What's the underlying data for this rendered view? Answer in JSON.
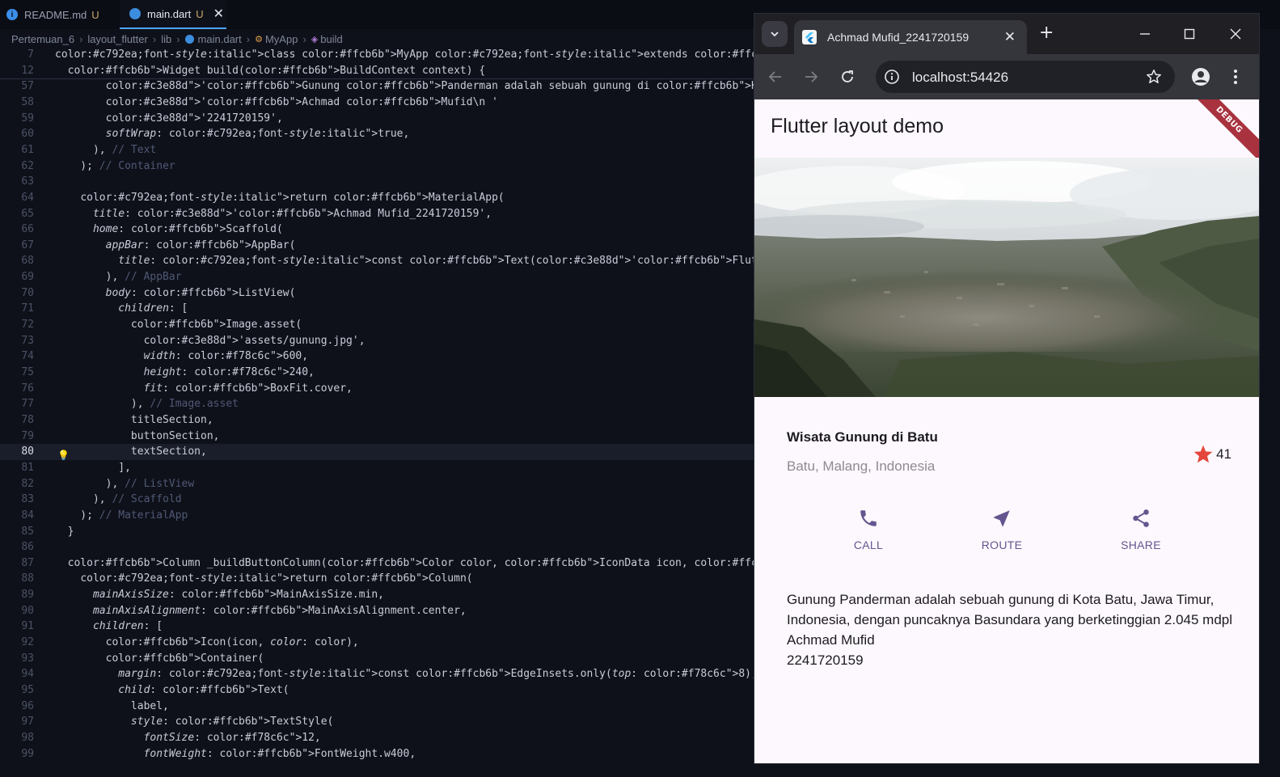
{
  "editor": {
    "tabs": [
      {
        "name": "README.md",
        "status": "U"
      },
      {
        "name": "main.dart",
        "status": "U",
        "close": "✕"
      }
    ],
    "breadcrumb": [
      "Pertemuan_6",
      "layout_flutter",
      "lib",
      "main.dart",
      "MyApp",
      "build"
    ],
    "lines": [
      {
        "n": "7",
        "t": "class MyApp extends StatelessWidget {"
      },
      {
        "n": "12",
        "t": "  Widget build(BuildContext context) {"
      },
      {
        "n": "57",
        "t": "        'Gunung Panderman adalah sebuah gunung di Kota Batu, Jawa Timur, Indonesia, dengan puncaknya Basundara"
      },
      {
        "n": "58",
        "t": "        'Achmad Mufid\\n '"
      },
      {
        "n": "59",
        "t": "        '2241720159',"
      },
      {
        "n": "60",
        "t": "        softWrap: true,"
      },
      {
        "n": "61",
        "t": "      ), // Text"
      },
      {
        "n": "62",
        "t": "    ); // Container"
      },
      {
        "n": "63",
        "t": ""
      },
      {
        "n": "64",
        "t": "    return MaterialApp("
      },
      {
        "n": "65",
        "t": "      title: 'Achmad Mufid_2241720159',"
      },
      {
        "n": "66",
        "t": "      home: Scaffold("
      },
      {
        "n": "67",
        "t": "        appBar: AppBar("
      },
      {
        "n": "68",
        "t": "          title: const Text('Flutter layout demo'),"
      },
      {
        "n": "69",
        "t": "        ), // AppBar"
      },
      {
        "n": "70",
        "t": "        body: ListView("
      },
      {
        "n": "71",
        "t": "          children: ["
      },
      {
        "n": "72",
        "t": "            Image.asset("
      },
      {
        "n": "73",
        "t": "              'assets/gunung.jpg',"
      },
      {
        "n": "74",
        "t": "              width: 600,"
      },
      {
        "n": "75",
        "t": "              height: 240,"
      },
      {
        "n": "76",
        "t": "              fit: BoxFit.cover,"
      },
      {
        "n": "77",
        "t": "            ), // Image.asset"
      },
      {
        "n": "78",
        "t": "            titleSection,"
      },
      {
        "n": "79",
        "t": "            buttonSection,"
      },
      {
        "n": "80",
        "t": "            textSection,"
      },
      {
        "n": "81",
        "t": "          ],"
      },
      {
        "n": "82",
        "t": "        ), // ListView"
      },
      {
        "n": "83",
        "t": "      ), // Scaffold"
      },
      {
        "n": "84",
        "t": "    ); // MaterialApp"
      },
      {
        "n": "85",
        "t": "  }"
      },
      {
        "n": "86",
        "t": ""
      },
      {
        "n": "87",
        "t": "  Column _buildButtonColumn(Color color, IconData icon, String label) {"
      },
      {
        "n": "88",
        "t": "    return Column("
      },
      {
        "n": "89",
        "t": "      mainAxisSize: MainAxisSize.min,"
      },
      {
        "n": "90",
        "t": "      mainAxisAlignment: MainAxisAlignment.center,"
      },
      {
        "n": "91",
        "t": "      children: ["
      },
      {
        "n": "92",
        "t": "        Icon(icon, color: color),"
      },
      {
        "n": "93",
        "t": "        Container("
      },
      {
        "n": "94",
        "t": "          margin: const EdgeInsets.only(top: 8),"
      },
      {
        "n": "95",
        "t": "          child: Text("
      },
      {
        "n": "96",
        "t": "            label,"
      },
      {
        "n": "97",
        "t": "            style: TextStyle("
      },
      {
        "n": "98",
        "t": "              fontSize: 12,"
      },
      {
        "n": "99",
        "t": "              fontWeight: FontWeight.w400,"
      }
    ],
    "current_line": "80"
  },
  "browser": {
    "tab_title": "Achmad Mufid_2241720159",
    "tab_close": "✕",
    "new_tab": "+",
    "url": "localhost:54426",
    "debug_banner": "DEBUG"
  },
  "app": {
    "appbar_title": "Flutter layout demo",
    "place_title": "Wisata Gunung di Batu",
    "place_subtitle": "Batu, Malang, Indonesia",
    "rating": "41",
    "buttons": [
      {
        "label": "CALL",
        "icon": "phone-icon"
      },
      {
        "label": "ROUTE",
        "icon": "near-me-icon"
      },
      {
        "label": "SHARE",
        "icon": "share-icon"
      }
    ],
    "description": "Gunung Panderman adalah sebuah gunung di Kota Batu, Jawa Timur, Indonesia, dengan puncaknya Basundara yang berketinggian 2.045 mdpl\n Achmad Mufid\n 2241720159",
    "colors": {
      "accent": "#65558f",
      "star": "#e4463c",
      "debug": "#a8323e"
    }
  }
}
